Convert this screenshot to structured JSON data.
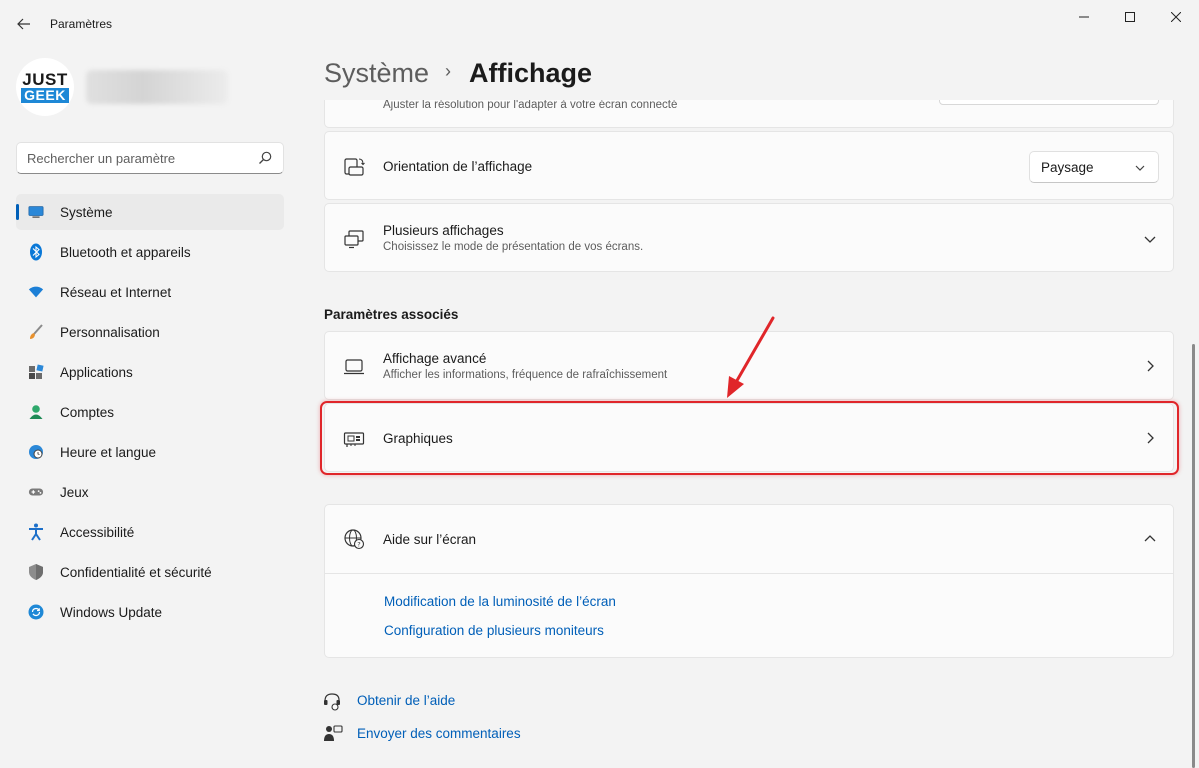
{
  "window": {
    "title": "Paramètres"
  },
  "profile": {
    "logo_line1": "JUST",
    "logo_line2": "GEEK"
  },
  "search": {
    "placeholder": "Rechercher un paramètre"
  },
  "sidebar": {
    "items": [
      {
        "label": "Système",
        "icon": "monitor-icon",
        "active": true
      },
      {
        "label": "Bluetooth et appareils",
        "icon": "bluetooth-icon"
      },
      {
        "label": "Réseau et Internet",
        "icon": "wifi-icon"
      },
      {
        "label": "Personnalisation",
        "icon": "brush-icon"
      },
      {
        "label": "Applications",
        "icon": "apps-icon"
      },
      {
        "label": "Comptes",
        "icon": "person-icon"
      },
      {
        "label": "Heure et langue",
        "icon": "globe-clock-icon"
      },
      {
        "label": "Jeux",
        "icon": "gamepad-icon"
      },
      {
        "label": "Accessibilité",
        "icon": "accessibility-icon"
      },
      {
        "label": "Confidentialité et sécurité",
        "icon": "shield-icon"
      },
      {
        "label": "Windows Update",
        "icon": "update-icon"
      }
    ]
  },
  "header": {
    "parent": "Système",
    "separator": "›",
    "current": "Affichage"
  },
  "main": {
    "clipped_row_sub": "Ajuster la résolution pour l'adapter à votre écran connecté",
    "orientation": {
      "title": "Orientation de l’affichage",
      "value": "Paysage"
    },
    "multiple_displays": {
      "title": "Plusieurs affichages",
      "subtitle": "Choisissez le mode de présentation de vos écrans."
    },
    "related_title": "Paramètres associés",
    "advanced_display": {
      "title": "Affichage avancé",
      "subtitle": "Afficher les informations, fréquence de rafraîchissement"
    },
    "graphics": {
      "title": "Graphiques"
    },
    "help": {
      "title": "Aide sur l’écran",
      "links": [
        "Modification de la luminosité de l’écran",
        "Configuration de plusieurs moniteurs"
      ]
    }
  },
  "footer": {
    "get_help": "Obtenir de l’aide",
    "send_feedback": "Envoyer des commentaires"
  },
  "colors": {
    "accent": "#005fb8",
    "highlight": "#e0262a",
    "background": "#f3f3f3",
    "card": "#fbfbfb"
  }
}
